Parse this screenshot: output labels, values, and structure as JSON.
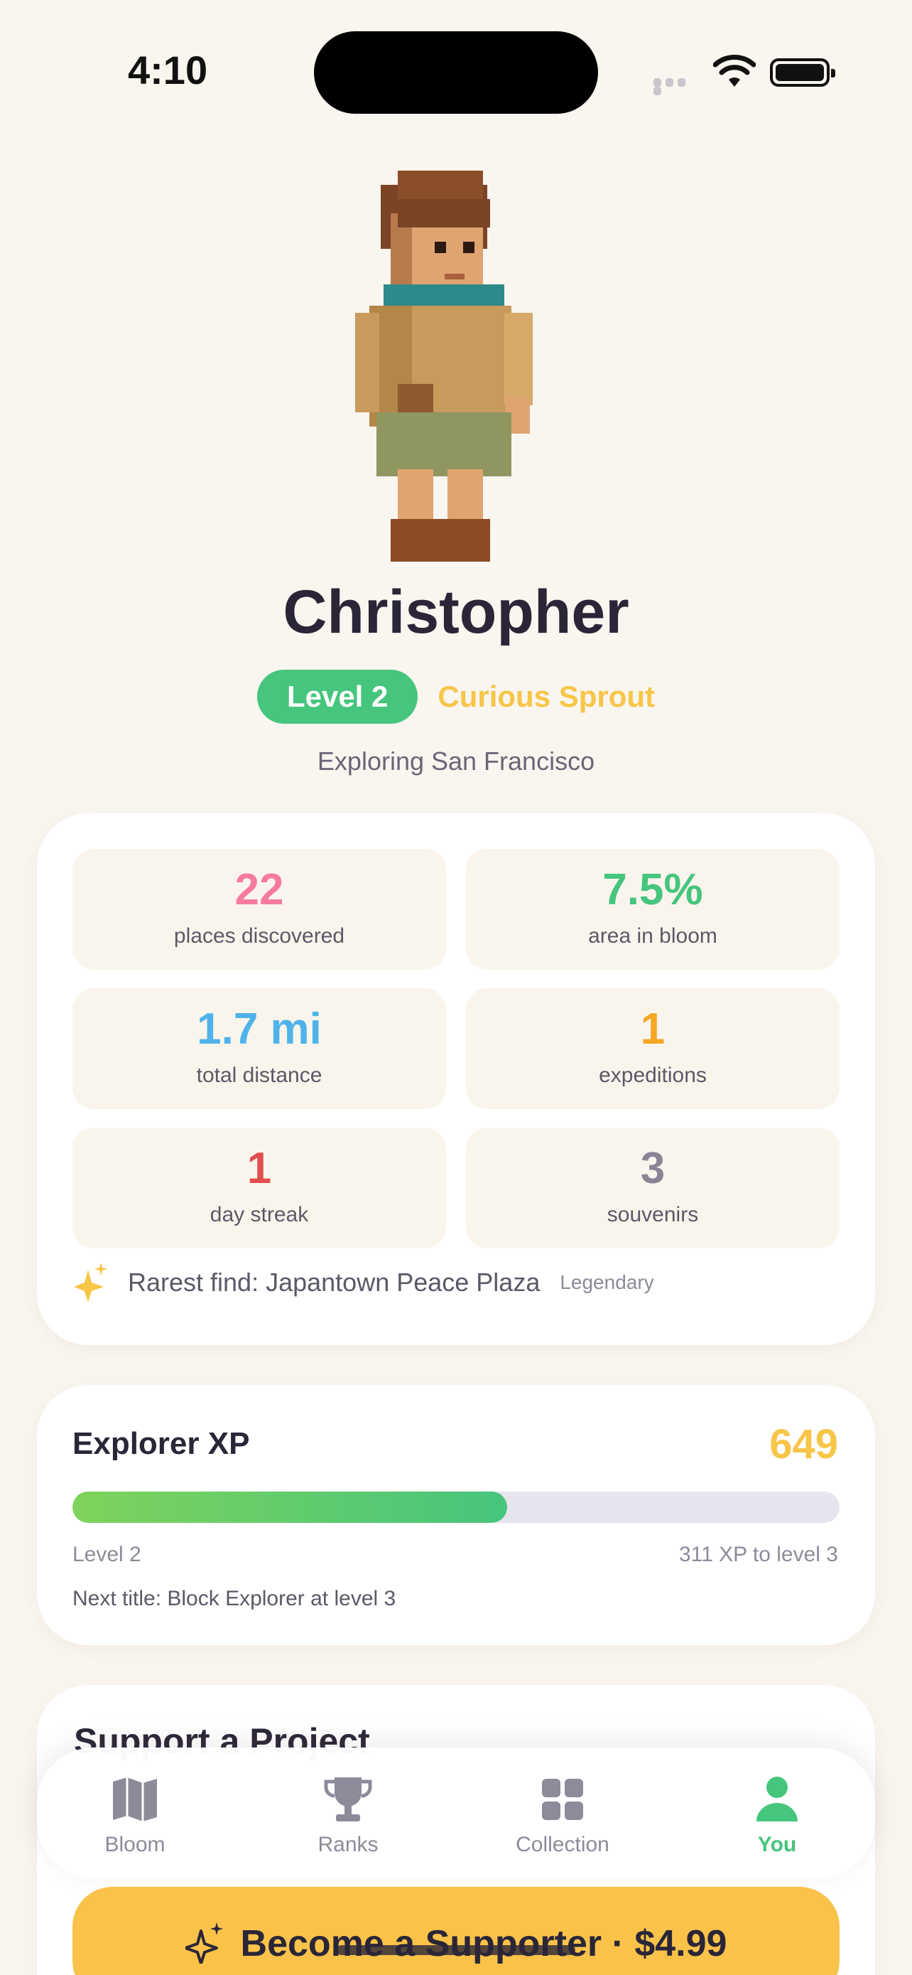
{
  "status_bar": {
    "time": "4:10"
  },
  "profile": {
    "name": "Christopher",
    "level_label": "Level 2",
    "title": "Curious Sprout",
    "location": "Exploring San Francisco"
  },
  "stats": [
    {
      "value": "22",
      "label": "places discovered",
      "color": "#f77b9b"
    },
    {
      "value": "7.5%",
      "label": "area in bloom",
      "color": "#46c57d"
    },
    {
      "value": "1.7 mi",
      "label": "total distance",
      "color": "#4fb3ea"
    },
    {
      "value": "1",
      "label": "expeditions",
      "color": "#f5a623"
    },
    {
      "value": "1",
      "label": "day streak",
      "color": "#e0504f"
    },
    {
      "value": "3",
      "label": "souvenirs",
      "color": "#8a8596"
    }
  ],
  "rarest": {
    "text": "Rarest find: Japantown Peace Plaza",
    "rarity": "Legendary"
  },
  "xp": {
    "title": "Explorer XP",
    "value": "649",
    "progress": 0.567,
    "current_level": "Level 2",
    "to_next": "311 XP to level 3",
    "next_title": "Next title: Block Explorer at level 3"
  },
  "supporter": {
    "peek_title": "Support a Project"
  },
  "tabs": [
    {
      "label": "Bloom",
      "icon": "map-icon"
    },
    {
      "label": "Ranks",
      "icon": "trophy-icon"
    },
    {
      "label": "Collection",
      "icon": "grid-icon"
    },
    {
      "label": "You",
      "icon": "person-icon",
      "active": true
    }
  ],
  "cta": {
    "label": "Become a Supporter · $4.99"
  },
  "colors": {
    "accent_green": "#46c57d",
    "accent_yellow": "#f7c548",
    "background": "#f9f5ef"
  }
}
